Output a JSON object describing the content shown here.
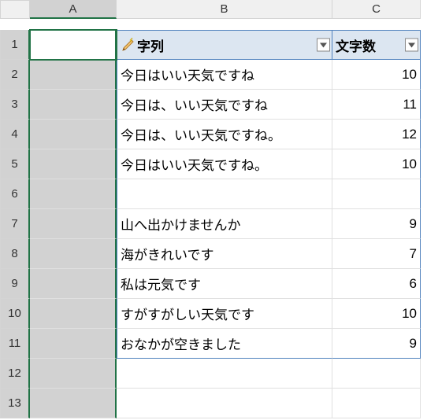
{
  "columns": [
    "A",
    "B",
    "C"
  ],
  "row_count": 13,
  "active_cell": "A1",
  "selected_column": "A",
  "table": {
    "headers": {
      "b": "字列",
      "c": "文字数"
    },
    "rows": [
      {
        "b": "今日はいい天気ですね",
        "c": "10"
      },
      {
        "b": "今日は、いい天気ですね",
        "c": "11"
      },
      {
        "b": "今日は、いい天気ですね。",
        "c": "12"
      },
      {
        "b": "今日はいい天気ですね。",
        "c": "10"
      },
      {
        "b": "",
        "c": ""
      },
      {
        "b": "山へ出かけませんか",
        "c": "9"
      },
      {
        "b": "海がきれいです",
        "c": "7"
      },
      {
        "b": "私は元気です",
        "c": "6"
      },
      {
        "b": "すがすがしい天気です",
        "c": "10"
      },
      {
        "b": "おなかが空きました",
        "c": "9"
      },
      {
        "b": "",
        "c": ""
      },
      {
        "b": "",
        "c": ""
      }
    ]
  },
  "chart_data": {
    "type": "table",
    "columns": [
      "字列",
      "文字数"
    ],
    "rows": [
      [
        "今日はいい天気ですね",
        10
      ],
      [
        "今日は、いい天気ですね",
        11
      ],
      [
        "今日は、いい天気ですね。",
        12
      ],
      [
        "今日はいい天気ですね。",
        10
      ],
      [
        "山へ出かけませんか",
        9
      ],
      [
        "海がきれいです",
        7
      ],
      [
        "私は元気です",
        6
      ],
      [
        "すがすがしい天気です",
        10
      ],
      [
        "おなかが空きました",
        9
      ]
    ]
  }
}
